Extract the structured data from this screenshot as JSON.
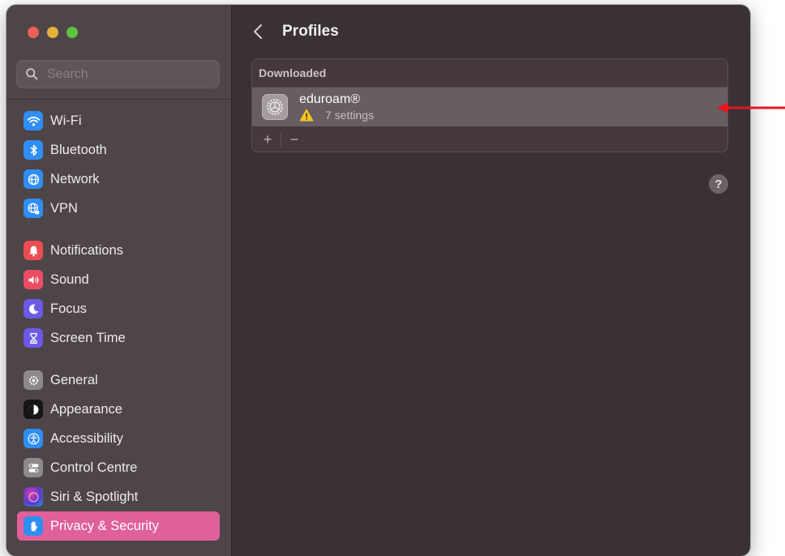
{
  "window": {
    "traffic_lights": [
      "close",
      "minimize",
      "zoom"
    ]
  },
  "search": {
    "placeholder": "Search",
    "icon": "search-icon"
  },
  "sidebar": {
    "groups": [
      [
        {
          "label": "Wi-Fi",
          "icon": "wifi-icon",
          "color": "#2f8ef3"
        },
        {
          "label": "Bluetooth",
          "icon": "bluetooth-icon",
          "color": "#2f8ef3"
        },
        {
          "label": "Network",
          "icon": "globe-icon",
          "color": "#2f8ef3"
        },
        {
          "label": "VPN",
          "icon": "vpn-globe-icon",
          "color": "#2f8ef3"
        }
      ],
      [
        {
          "label": "Notifications",
          "icon": "bell-icon",
          "color": "#ec4d52"
        },
        {
          "label": "Sound",
          "icon": "speaker-icon",
          "color": "#ec4d65"
        },
        {
          "label": "Focus",
          "icon": "moon-icon",
          "color": "#6b5ae6"
        },
        {
          "label": "Screen Time",
          "icon": "hourglass-icon",
          "color": "#6b5ae6"
        }
      ],
      [
        {
          "label": "General",
          "icon": "gear-icon",
          "color": "#8e8a8c"
        },
        {
          "label": "Appearance",
          "icon": "appearance-icon",
          "color": "#151515"
        },
        {
          "label": "Accessibility",
          "icon": "accessibility-icon",
          "color": "#2f8ef3"
        },
        {
          "label": "Control Centre",
          "icon": "toggles-icon",
          "color": "#8e8a8c"
        },
        {
          "label": "Siri & Spotlight",
          "icon": "siri-icon",
          "color": "#4a3c8f"
        },
        {
          "label": "Privacy & Security",
          "icon": "hand-icon",
          "color": "#2f8ef3",
          "active": true
        }
      ]
    ]
  },
  "main": {
    "title": "Profiles",
    "back_icon": "chevron-left-icon",
    "section_header": "Downloaded",
    "profiles": [
      {
        "name": "eduroam®",
        "status_icon": "warning-icon",
        "settings": "7 settings",
        "icon": "settings-gear-icon",
        "selected": true
      }
    ],
    "footer": {
      "add": "+",
      "remove": "−"
    },
    "help": "?"
  },
  "annotation": {
    "type": "arrow",
    "color": "#e3181f",
    "points_to": "profile-row-eduroam"
  }
}
